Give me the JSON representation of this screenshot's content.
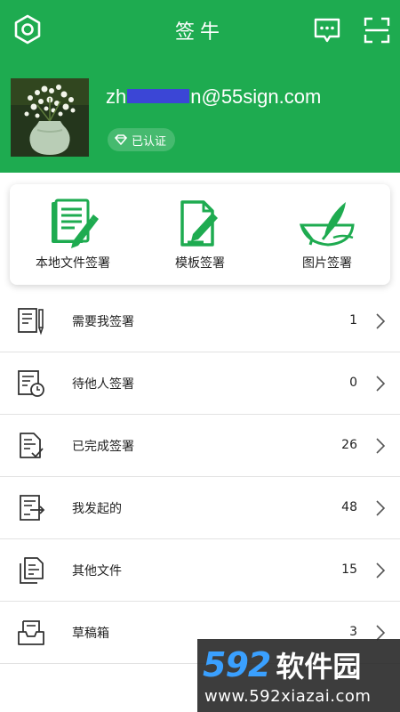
{
  "header": {
    "title": "签牛",
    "email_prefix": "zh",
    "email_suffix": "n@55sign.com",
    "verified_label": "已认证"
  },
  "actions": [
    {
      "label": "本地文件签署",
      "icon": "document-pen-icon"
    },
    {
      "label": "模板签署",
      "icon": "template-edit-icon"
    },
    {
      "label": "图片签署",
      "icon": "image-quill-icon"
    }
  ],
  "list": [
    {
      "label": "需要我签署",
      "count": "1",
      "icon": "document-pen-icon"
    },
    {
      "label": "待他人签署",
      "count": "0",
      "icon": "document-clock-icon"
    },
    {
      "label": "已完成签署",
      "count": "26",
      "icon": "document-check-icon"
    },
    {
      "label": "我发起的",
      "count": "48",
      "icon": "document-send-icon"
    },
    {
      "label": "其他文件",
      "count": "15",
      "icon": "documents-icon"
    },
    {
      "label": "草稿箱",
      "count": "3",
      "icon": "inbox-tray-icon"
    }
  ],
  "watermark": {
    "num": "592",
    "name": "软件园",
    "url": "www.592xiazai.com"
  },
  "colors": {
    "brand_green": "#1eab50",
    "mask_blue": "#3b46d6"
  }
}
